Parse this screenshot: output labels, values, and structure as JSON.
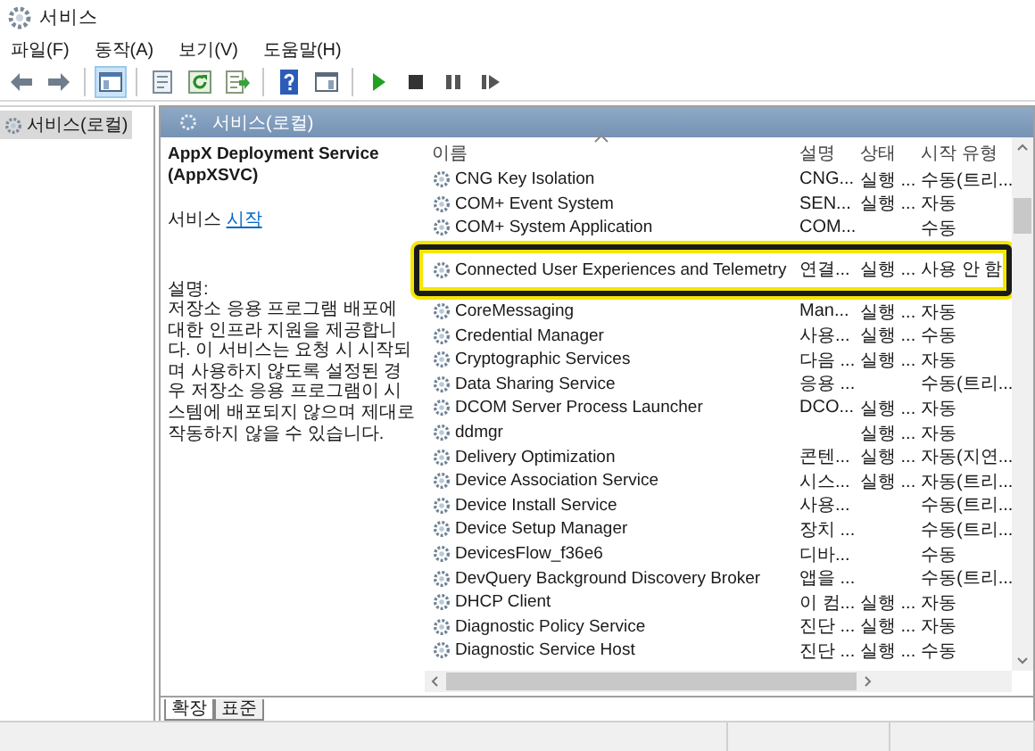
{
  "window": {
    "title": "서비스"
  },
  "menu": [
    "파일(F)",
    "동작(A)",
    "보기(V)",
    "도움말(H)"
  ],
  "toolbar": [
    {
      "kind": "back"
    },
    {
      "kind": "forward"
    },
    {
      "kind": "sep"
    },
    {
      "kind": "console",
      "selected": true
    },
    {
      "kind": "sep"
    },
    {
      "kind": "sheet"
    },
    {
      "kind": "refresh"
    },
    {
      "kind": "export"
    },
    {
      "kind": "sep"
    },
    {
      "kind": "help"
    },
    {
      "kind": "console2"
    },
    {
      "kind": "sep"
    },
    {
      "kind": "play"
    },
    {
      "kind": "stop"
    },
    {
      "kind": "pause"
    },
    {
      "kind": "resume"
    }
  ],
  "tree": {
    "items": [
      {
        "label": "서비스(로컬)",
        "selected": true
      }
    ]
  },
  "pane_header": "서비스(로컬)",
  "detail": {
    "service_name": "AppX Deployment Service (AppXSVC)",
    "action_prefix": "서비스",
    "action_link": "시작",
    "description_label": "설명:",
    "description": "저장소 응용 프로그램 배포에 대한 인프라 지원을 제공합니다. 이 서비스는 요청 시 시작되며 사용하지 않도록 설정된 경우 저장소 응용 프로그램이 시스템에 배포되지 않으며 제대로 작동하지 않을 수 있습니다."
  },
  "table": {
    "columns": [
      "이름",
      "설명",
      "상태",
      "시작 유형"
    ],
    "rows": [
      {
        "name": "CNG Key Isolation",
        "description": "CNG...",
        "status": "실행 ...",
        "startup": "수동(트리...",
        "highlighted": false
      },
      {
        "name": "COM+ Event System",
        "description": "SEN...",
        "status": "실행 ...",
        "startup": "자동",
        "highlighted": false
      },
      {
        "name": "COM+ System Application",
        "description": "COM...",
        "status": "",
        "startup": "수동",
        "highlighted": false
      },
      {
        "name": "Connected User Experiences and Telemetry",
        "description": "연결...",
        "status": "실행 ...",
        "startup": "사용 안 함",
        "highlighted": true
      },
      {
        "name": "CoreMessaging",
        "description": "Man...",
        "status": "실행 ...",
        "startup": "자동",
        "highlighted": false
      },
      {
        "name": "Credential Manager",
        "description": "사용...",
        "status": "실행 ...",
        "startup": "수동",
        "highlighted": false
      },
      {
        "name": "Cryptographic Services",
        "description": "다음 ...",
        "status": "실행 ...",
        "startup": "자동",
        "highlighted": false
      },
      {
        "name": "Data Sharing Service",
        "description": "응용 ...",
        "status": "",
        "startup": "수동(트리...",
        "highlighted": false
      },
      {
        "name": "DCOM Server Process Launcher",
        "description": "DCO...",
        "status": "실행 ...",
        "startup": "자동",
        "highlighted": false
      },
      {
        "name": "ddmgr",
        "description": "",
        "status": "실행 ...",
        "startup": "자동",
        "highlighted": false
      },
      {
        "name": "Delivery Optimization",
        "description": "콘텐...",
        "status": "실행 ...",
        "startup": "자동(지연...",
        "highlighted": false
      },
      {
        "name": "Device Association Service",
        "description": "시스...",
        "status": "실행 ...",
        "startup": "자동(트리...",
        "highlighted": false
      },
      {
        "name": "Device Install Service",
        "description": "사용...",
        "status": "",
        "startup": "수동(트리...",
        "highlighted": false
      },
      {
        "name": "Device Setup Manager",
        "description": "장치 ...",
        "status": "",
        "startup": "수동(트리...",
        "highlighted": false
      },
      {
        "name": "DevicesFlow_f36e6",
        "description": "디바...",
        "status": "",
        "startup": "수동",
        "highlighted": false
      },
      {
        "name": "DevQuery Background Discovery Broker",
        "description": "앱을 ...",
        "status": "",
        "startup": "수동(트리...",
        "highlighted": false
      },
      {
        "name": "DHCP Client",
        "description": "이 컴...",
        "status": "실행 ...",
        "startup": "자동",
        "highlighted": false
      },
      {
        "name": "Diagnostic Policy Service",
        "description": "진단 ...",
        "status": "실행 ...",
        "startup": "자동",
        "highlighted": false
      },
      {
        "name": "Diagnostic Service Host",
        "description": "진단 ...",
        "status": "실행 ...",
        "startup": "수동",
        "highlighted": false
      }
    ]
  },
  "view_tabs": [
    {
      "label": "확장",
      "selected": true
    },
    {
      "label": "표준",
      "selected": false
    }
  ]
}
